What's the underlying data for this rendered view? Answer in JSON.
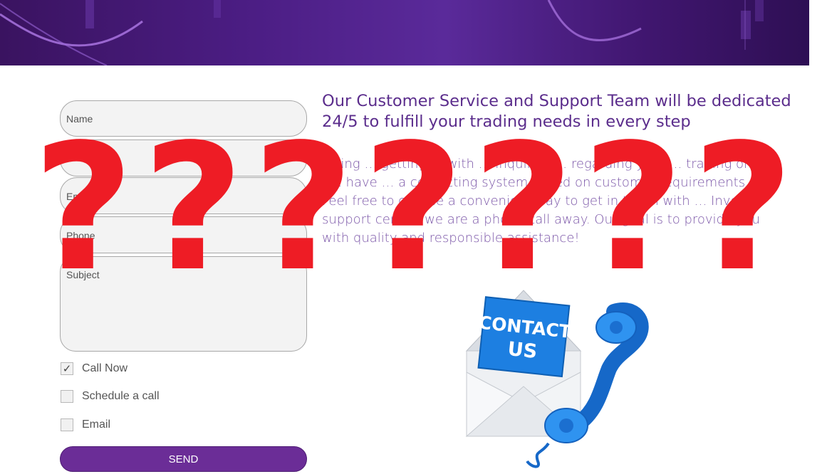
{
  "form": {
    "name_placeholder": "Name",
    "email_placeholder": "Email",
    "phone_placeholder": "Phone",
    "subject_placeholder": "Subject",
    "options": [
      {
        "label": "Call Now",
        "checked": true
      },
      {
        "label": "Schedule a call",
        "checked": false
      },
      {
        "label": "Email",
        "checked": false
      }
    ],
    "checkmark": "✓",
    "send_label": "SEND"
  },
  "content": {
    "headline": "Our Customer Service and Support Team will be dedicated 24/5 to fulfill your trading needs in every step",
    "body": "Trying … getting … with … inquiries … regarding your … trading or … ? We have … a contacting system based on customer requirements. Feel free to choose a convenient way to get in touch with … Investus support center, we are a phone call away. Our goal is to provide you with quality and responsible assistance!"
  },
  "illustration": {
    "line1": "CONTACT",
    "line2": "US"
  },
  "overlay": {
    "marks": [
      "?",
      "?",
      "?",
      "?",
      "?",
      "?",
      "?"
    ]
  },
  "colors": {
    "accent": "#6b2d97",
    "headline": "#5b2d8c",
    "overlay_red": "#ee1c25",
    "phone_blue": "#1a7fe0"
  }
}
